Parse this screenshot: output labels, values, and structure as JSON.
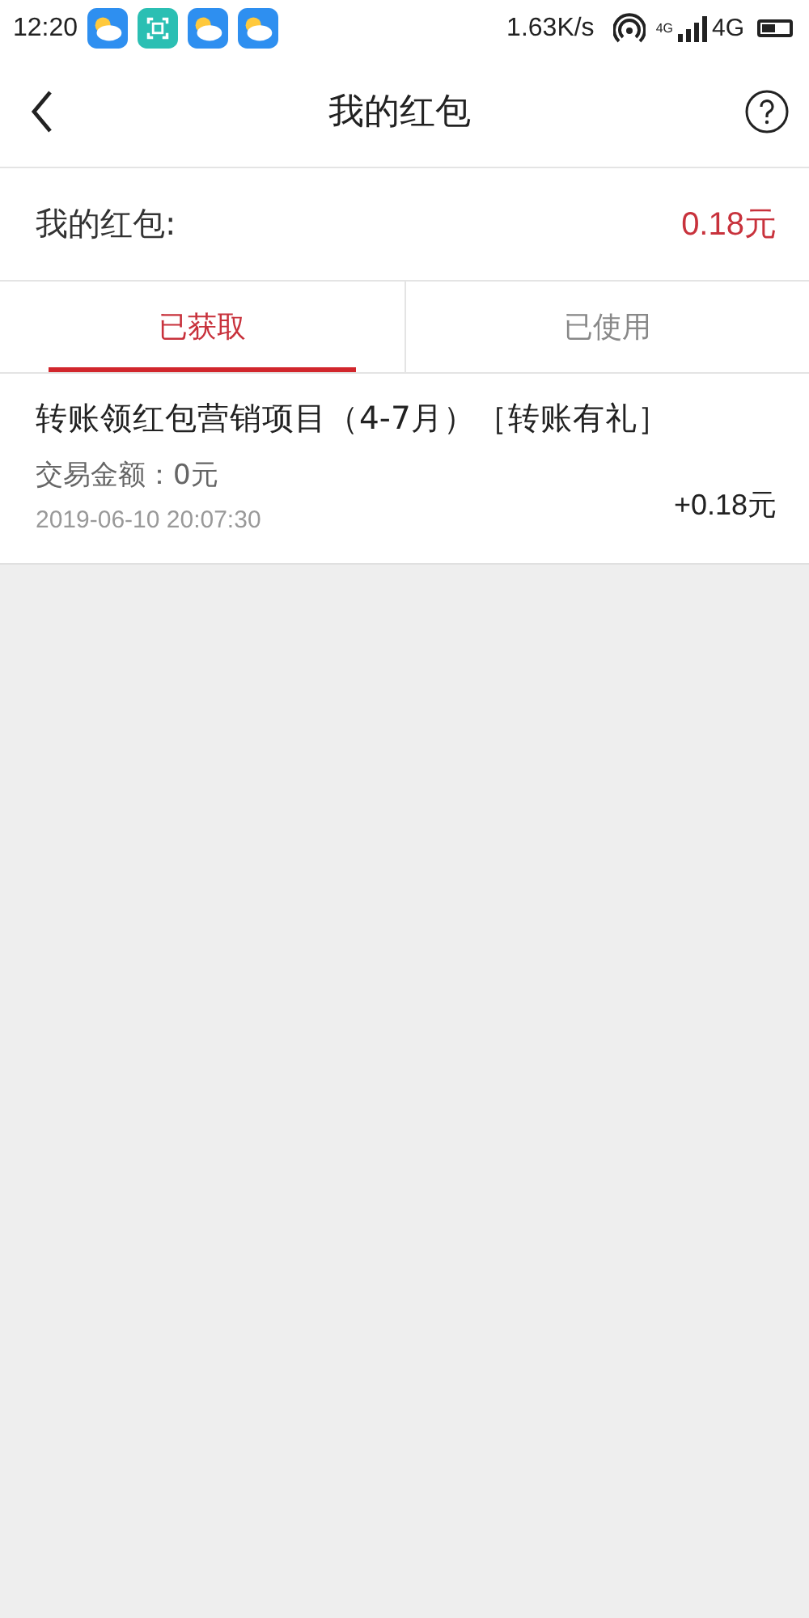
{
  "status_bar": {
    "time": "12:20",
    "network_speed": "1.63K/s",
    "network_small": "4G",
    "network": "4G"
  },
  "header": {
    "title": "我的红包"
  },
  "summary": {
    "label": "我的红包:",
    "amount": "0.18元"
  },
  "tabs": [
    {
      "label": "已获取",
      "selected": true
    },
    {
      "label": "已使用",
      "selected": false
    }
  ],
  "records": [
    {
      "title": "转账领红包营销项目（4-7月）［转账有礼］",
      "transaction": "交易金额：0元",
      "time": "2019-06-10 20:07:30",
      "amount": "+0.18元"
    }
  ]
}
